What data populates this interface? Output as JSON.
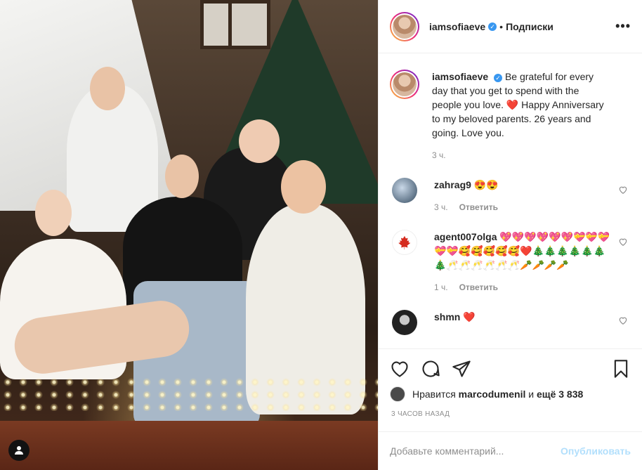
{
  "post": {
    "username": "iamsofiaeve",
    "separator": "•",
    "follow_label": "Подписки",
    "more_label": "•••"
  },
  "caption": {
    "username": "iamsofiaeve",
    "text": "Be grateful for every day that you get to spend with the people you love. ❤️ Happy Anniversary to my beloved parents. 26 years and going. Love you.",
    "time": "3 ч."
  },
  "comments": [
    {
      "username": "zahrag9",
      "text": "😍😍",
      "time": "3 ч.",
      "reply": "Ответить"
    },
    {
      "username": "agent007olga",
      "text": "💖💖💖💖💖💖💝💝💝💝💝🥰🥰🥰🥰🥰❤️🎄🎄🎄🎄🎄🎄🎄🥂🥂🥂🥂🥂🥂🥕🥕🥕🥕",
      "time": "1 ч.",
      "reply": "Ответить"
    },
    {
      "username": "shmn",
      "text": "❤️"
    }
  ],
  "likes": {
    "prefix": "Нравится",
    "user": "marcodumenil",
    "middle": "и",
    "rest": "ещё 3 838"
  },
  "timestamp": "3 ЧАСОВ НАЗАД",
  "add_comment": {
    "placeholder": "Добавьте комментарий...",
    "publish_label": "Опубликовать"
  },
  "icons": {
    "verified": "verified-badge-icon",
    "like": "heart-icon",
    "comment": "comment-bubble-icon",
    "share": "paper-plane-icon",
    "save": "bookmark-icon",
    "tag": "user-tag-icon"
  },
  "colors": {
    "verified_blue": "#3897f0",
    "publish_disabled": "#b2dffc",
    "meta_grey": "#8e8e8e"
  }
}
